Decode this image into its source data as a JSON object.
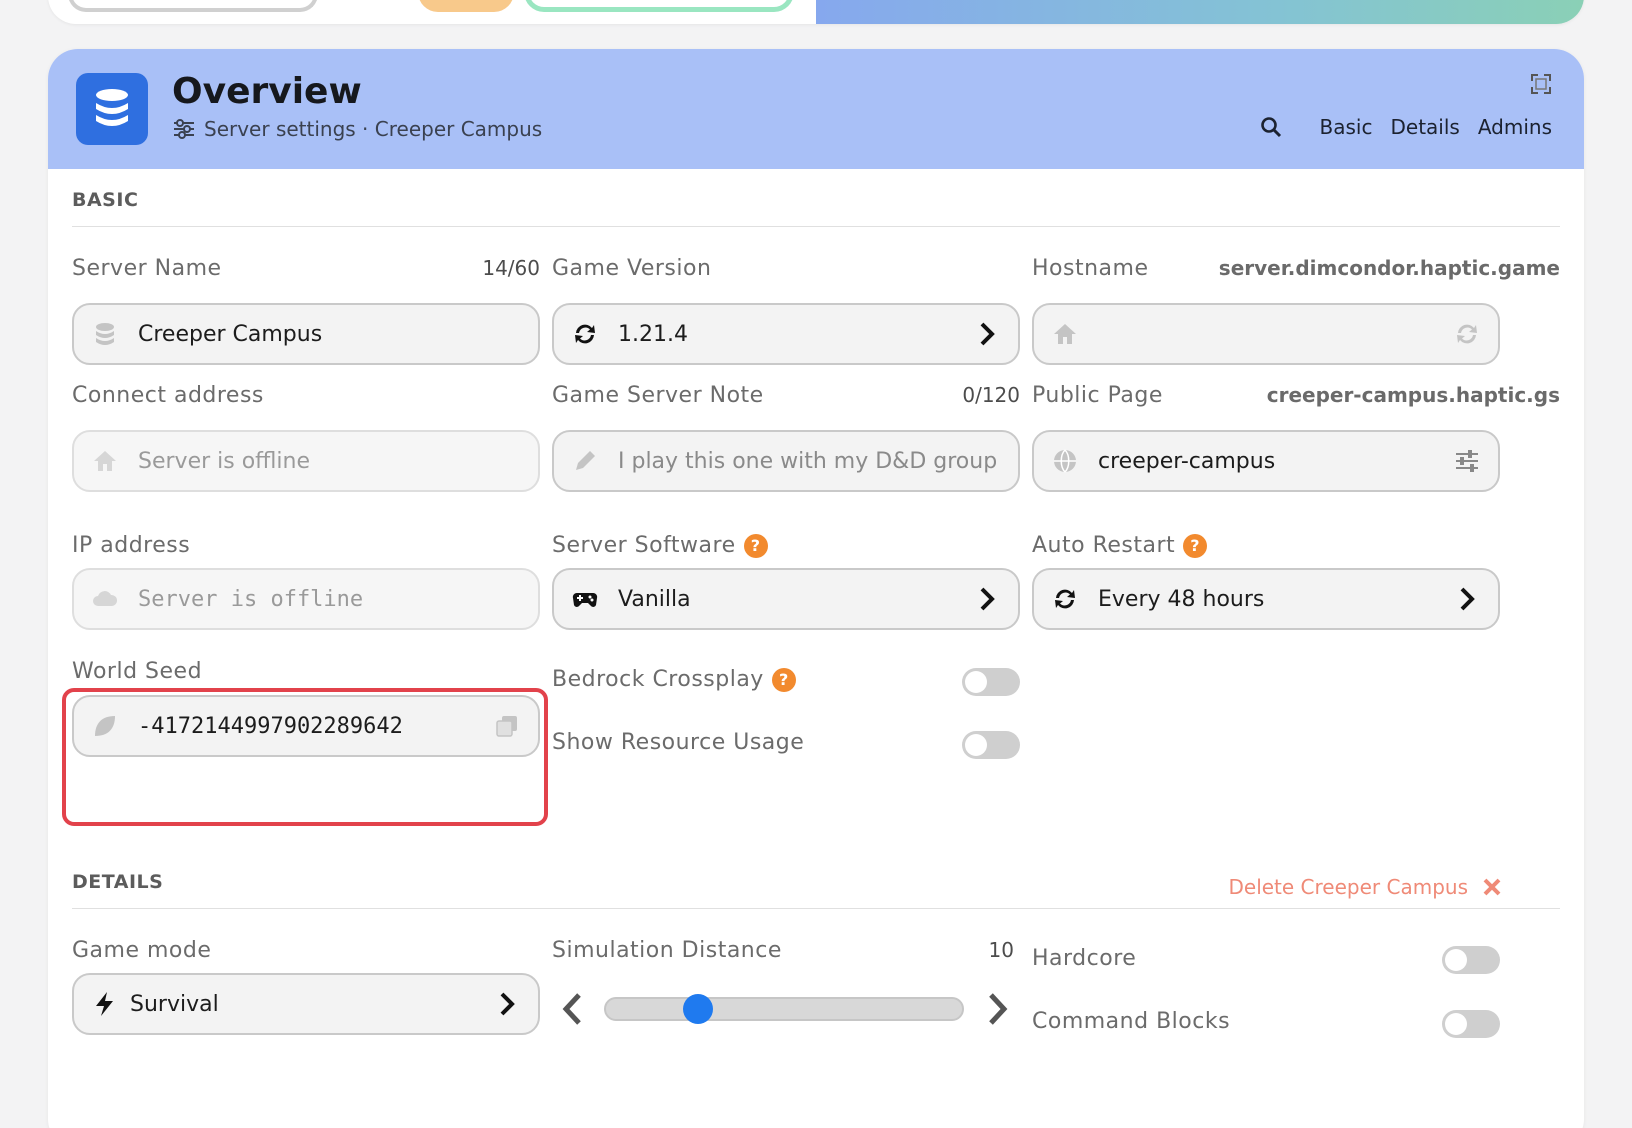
{
  "header": {
    "title": "Overview",
    "subtitle": "Server settings · Creeper Campus",
    "nav": [
      "Basic",
      "Details",
      "Admins"
    ]
  },
  "sections": {
    "basic": "BASIC",
    "details": "DETAILS"
  },
  "fields": {
    "server_name": {
      "label": "Server Name",
      "counter": "14/60",
      "value": "Creeper Campus"
    },
    "game_version": {
      "label": "Game Version",
      "value": "1.21.4"
    },
    "hostname": {
      "label": "Hostname",
      "hint": "server.dimcondor.haptic.game",
      "value": ""
    },
    "connect_address": {
      "label": "Connect address",
      "placeholder": "Server is offline"
    },
    "server_note": {
      "label": "Game Server Note",
      "counter": "0/120",
      "placeholder": "I play this one with my D&D group"
    },
    "public_page": {
      "label": "Public Page",
      "hint": "creeper-campus.haptic.gs",
      "value": "creeper-campus"
    },
    "ip_address": {
      "label": "IP address",
      "placeholder": "Server is offline"
    },
    "server_software": {
      "label": "Server Software",
      "value": "Vanilla"
    },
    "auto_restart": {
      "label": "Auto Restart",
      "value": "Every 48 hours"
    },
    "world_seed": {
      "label": "World Seed",
      "value": "-4172144997902289642"
    },
    "bedrock_crossplay": {
      "label": "Bedrock Crossplay",
      "enabled": false
    },
    "resource_usage": {
      "label": "Show Resource Usage",
      "enabled": false
    },
    "delete": {
      "label": "Delete Creeper Campus"
    },
    "game_mode": {
      "label": "Game mode",
      "value": "Survival"
    },
    "simulation_distance": {
      "label": "Simulation Distance",
      "value": "10",
      "slider_fraction": 0.26
    },
    "hardcore": {
      "label": "Hardcore",
      "enabled": false
    },
    "command_blocks": {
      "label": "Command Blocks",
      "enabled": false
    }
  },
  "colors": {
    "header_bg": "#a9c0f7",
    "accent": "#2f6fe0",
    "help": "#f28a2e",
    "danger": "#ef8a77",
    "slider": "#1f7aef"
  }
}
